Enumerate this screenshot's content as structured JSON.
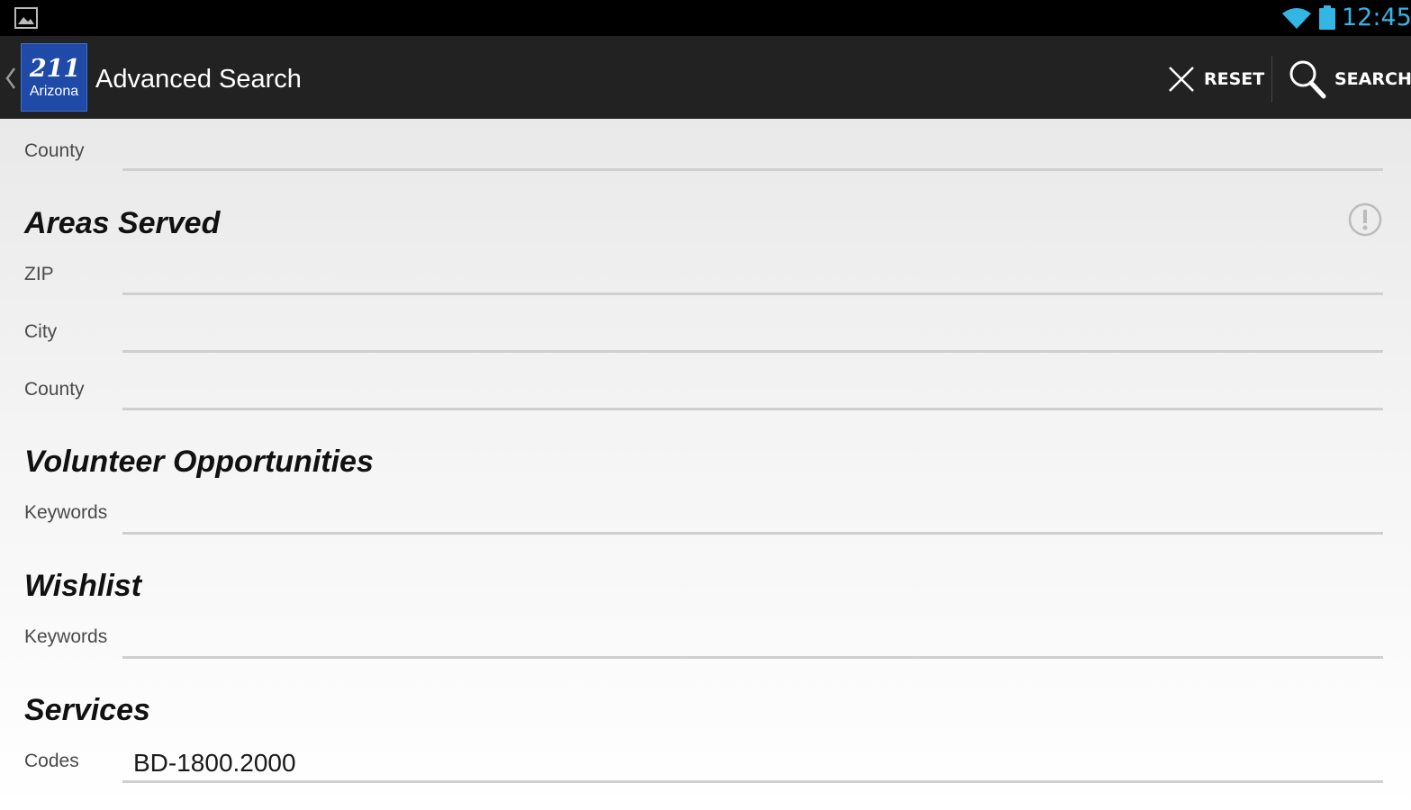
{
  "status_bar": {
    "time": "12:45",
    "icons": [
      "image-notification-icon",
      "wifi-icon",
      "battery-icon"
    ],
    "accent_color": "#33b5e5"
  },
  "action_bar": {
    "logo": {
      "number": "211",
      "text": "Arizona"
    },
    "title": "Advanced Search",
    "reset_label": "RESET",
    "search_label": "SEARCH",
    "background": "#222222"
  },
  "form": {
    "top_county_label": "County",
    "areas_served": {
      "heading": "Areas Served",
      "zip_label": "ZIP",
      "city_label": "City",
      "county_label": "County"
    },
    "volunteer": {
      "heading": "Volunteer Opportunities",
      "keywords_label": "Keywords"
    },
    "wishlist": {
      "heading": "Wishlist",
      "keywords_label": "Keywords"
    },
    "services": {
      "heading": "Services",
      "codes_label": "Codes",
      "codes_value": "BD-1800.2000"
    }
  }
}
